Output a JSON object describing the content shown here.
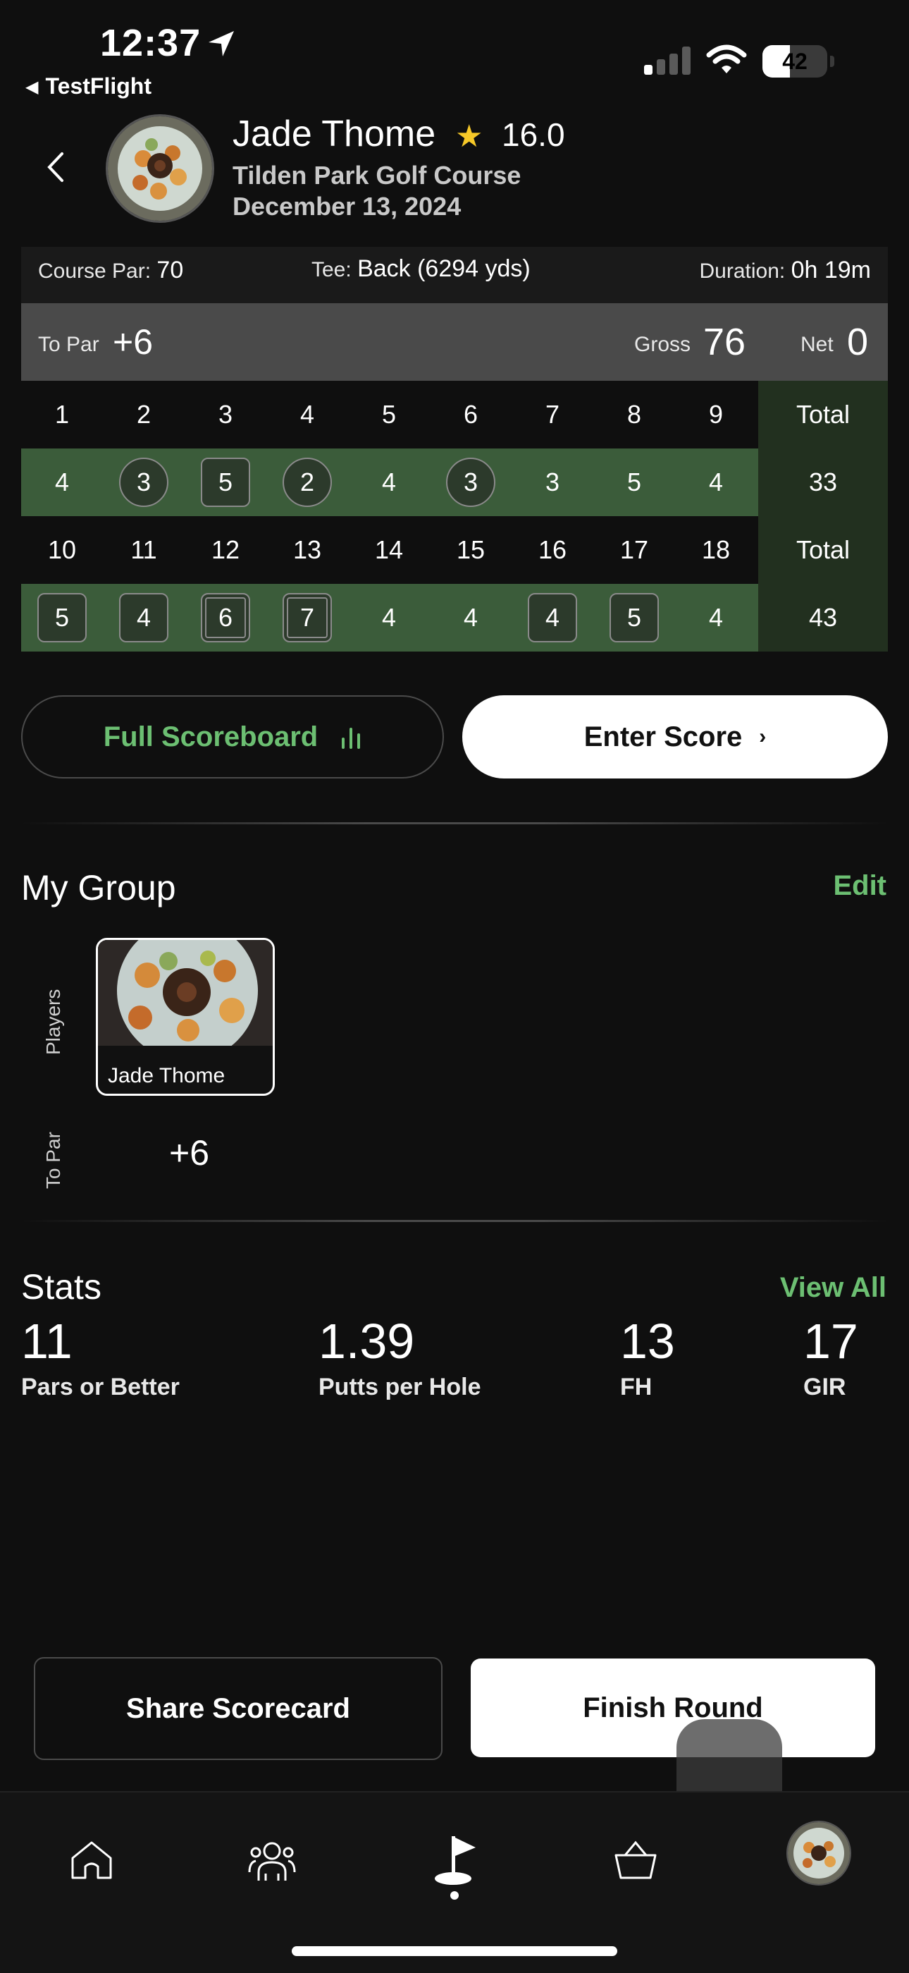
{
  "status_bar": {
    "time": "12:37",
    "back_app": "TestFlight",
    "battery": "42",
    "battery_level": 0.42
  },
  "header": {
    "player_name": "Jade Thome",
    "handicap": "16.0",
    "course": "Tilden Park Golf Course",
    "date": "December 13, 2024"
  },
  "round_info": {
    "par_label": "Course Par:",
    "par_value": "70",
    "tee_label": "Tee:",
    "tee_value": "Back (6294 yds)",
    "duration_label": "Duration:",
    "duration_value": "0h 19m"
  },
  "summary": {
    "to_par_label": "To Par",
    "to_par_value": "+6",
    "gross_label": "Gross",
    "gross_value": "76",
    "net_label": "Net",
    "net_value": "0"
  },
  "scorecard": {
    "front": {
      "holes": [
        "1",
        "2",
        "3",
        "4",
        "5",
        "6",
        "7",
        "8",
        "9"
      ],
      "scores": [
        "4",
        "3",
        "5",
        "2",
        "4",
        "3",
        "3",
        "5",
        "4"
      ],
      "marks": [
        "none",
        "circle",
        "square",
        "circle",
        "none",
        "circle",
        "none",
        "none",
        "none"
      ],
      "total_label": "Total",
      "total": "33"
    },
    "back": {
      "holes": [
        "10",
        "11",
        "12",
        "13",
        "14",
        "15",
        "16",
        "17",
        "18"
      ],
      "scores": [
        "5",
        "4",
        "6",
        "7",
        "4",
        "4",
        "4",
        "5",
        "4"
      ],
      "marks": [
        "square",
        "square",
        "dsquare",
        "dsquare",
        "none",
        "none",
        "square",
        "square",
        "none"
      ],
      "total_label": "Total",
      "total": "43"
    }
  },
  "actions": {
    "full_scoreboard": "Full Scoreboard",
    "enter_score": "Enter Score"
  },
  "group": {
    "title": "My Group",
    "edit": "Edit",
    "players_label": "Players",
    "to_par_label": "To Par",
    "player": {
      "name": "Jade Thome",
      "to_par": "+6"
    }
  },
  "stats": {
    "title": "Stats",
    "view_all": "View All",
    "items": [
      {
        "value": "11",
        "label": "Pars or Better"
      },
      {
        "value": "1.39",
        "label": "Putts per Hole"
      },
      {
        "value": "13",
        "label": "FH"
      },
      {
        "value": "17",
        "label": "GIR"
      }
    ]
  },
  "bottom": {
    "share": "Share Scorecard",
    "finish": "Finish Round"
  },
  "tabbar": {
    "tabs": [
      "home-icon",
      "people-icon",
      "flag-icon",
      "basket-icon",
      "profile-avatar"
    ],
    "active": "flag-icon"
  },
  "colors": {
    "accent_green": "#6cbf72",
    "score_row_green": "#3b5c3a",
    "background": "#0f0f0f"
  }
}
